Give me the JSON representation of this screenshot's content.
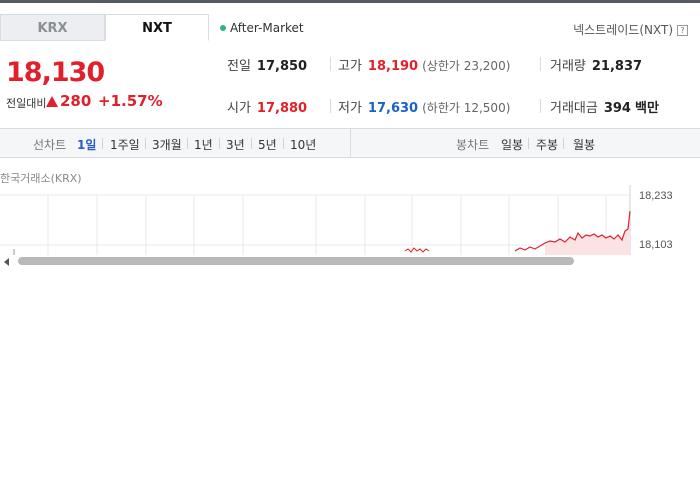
{
  "market_tabs": [
    {
      "label": "KRX",
      "active": false
    },
    {
      "label": "NXT",
      "active": true
    }
  ],
  "session": {
    "label": "After-Market",
    "status_color": "#2fb48a"
  },
  "exchange": {
    "label": "넥스트레이드(NXT)",
    "help_icon": "?"
  },
  "price": {
    "current": "18,130",
    "change_label": "전일대비",
    "change_icon": "up-triangle-icon",
    "change": "280",
    "change_pct": "+1.57%"
  },
  "stats": {
    "prev_close": {
      "label": "전일",
      "value": "17,850"
    },
    "high": {
      "label": "고가",
      "value": "18,190",
      "sub": "(상한가 23,200)"
    },
    "volume": {
      "label": "거래량",
      "value": "21,837"
    },
    "open": {
      "label": "시가",
      "value": "17,880"
    },
    "low": {
      "label": "저가",
      "value": "17,630",
      "sub": "(하한가 12,500)"
    },
    "amount": {
      "label": "거래대금",
      "value": "394",
      "unit": "백만"
    }
  },
  "line_chart_tabs": {
    "header": "선차트",
    "items": [
      "1일",
      "1주일",
      "3개월",
      "1년",
      "3년",
      "5년",
      "10년"
    ],
    "selected": "1일"
  },
  "candle_chart_tabs": {
    "header": "봉차트",
    "items": [
      "일봉",
      "주봉",
      "월봉"
    ]
  },
  "chart": {
    "title": "한국거래소(KRX)",
    "y_ticks": [
      "18,233",
      "18,103"
    ],
    "line_color": "#e0212b",
    "area_color": "#fbe3e4"
  },
  "colors": {
    "up": "#e0212b",
    "down": "#1a62c9",
    "selected_tab": "#2a59c8"
  }
}
